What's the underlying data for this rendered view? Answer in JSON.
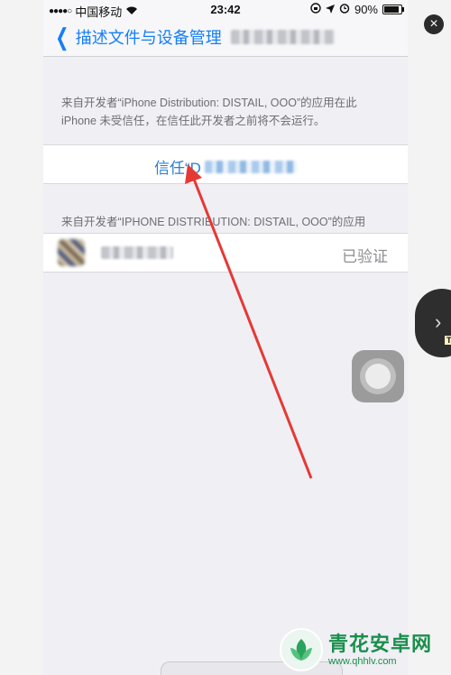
{
  "status_bar": {
    "carrier": "中国移动",
    "time": "23:42",
    "battery_percent": "90%",
    "battery_level": 0.9
  },
  "nav": {
    "back_label": "描述文件与设备管理"
  },
  "trust_section": {
    "description": "来自开发者“iPhone Distribution: DISTAIL, OOO”的应用在此 iPhone 未受信任，在信任此开发者之前将不会运行。",
    "trust_button_label": "信任“D"
  },
  "apps_section": {
    "header": "来自开发者“IPHONE DISTRIBUTION: DISTAIL, OOO”的应用",
    "app_status": "已验证"
  },
  "side_handle": {
    "chevron": "›",
    "tag": "T"
  },
  "close": {
    "glyph": "×"
  },
  "watermark": {
    "title": "青花安卓网",
    "url": "www.qhhlv.com"
  },
  "colors": {
    "ios_blue": "#157efb",
    "arrow_red": "#e53935",
    "watermark_green": "#1a8f4c"
  }
}
